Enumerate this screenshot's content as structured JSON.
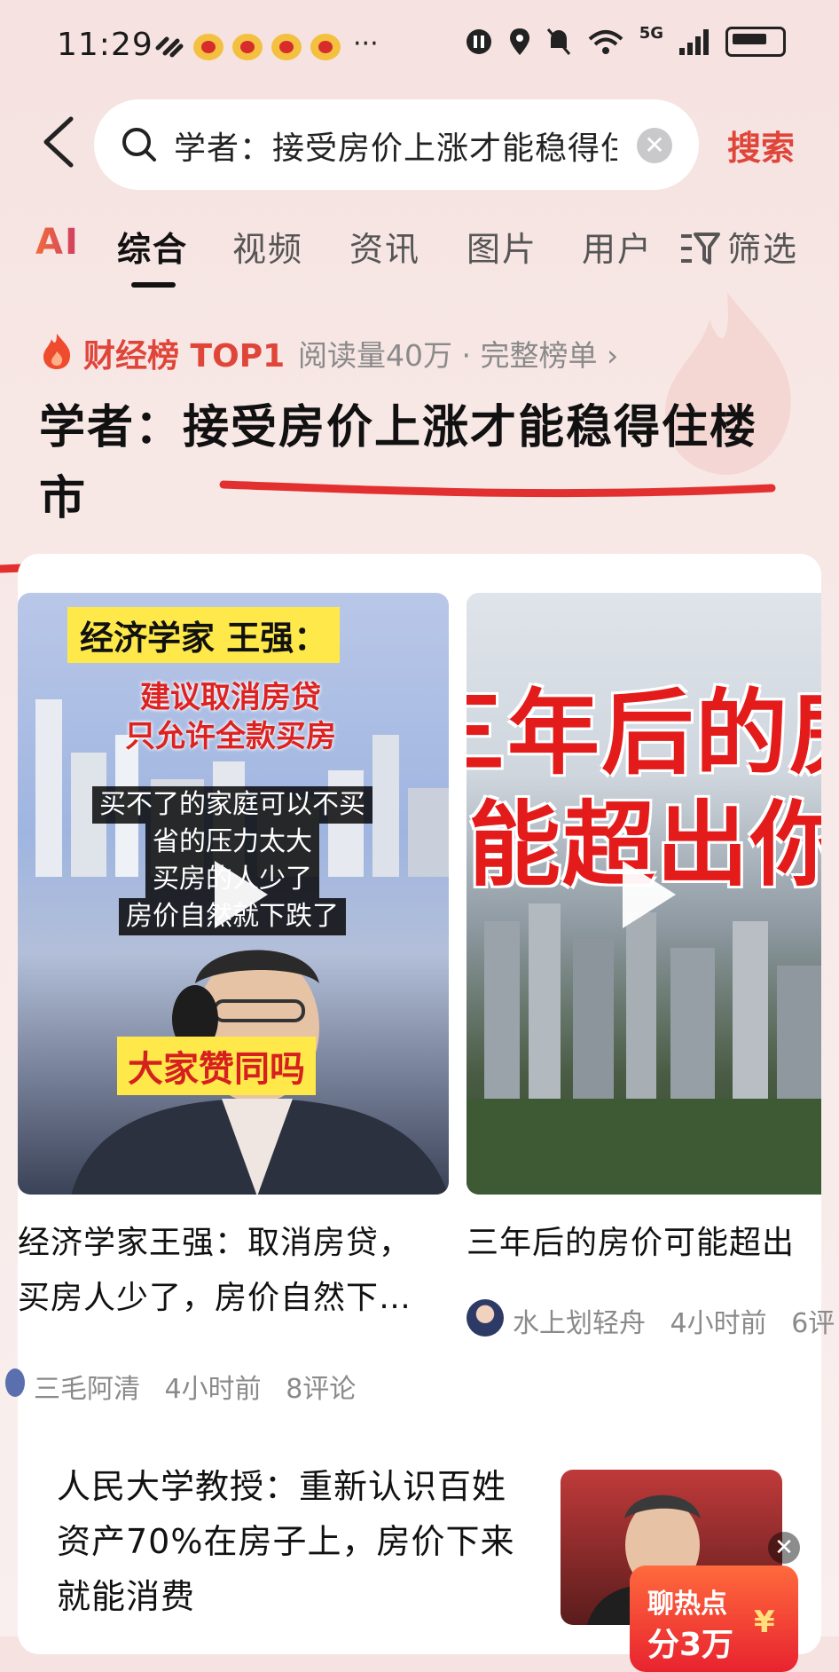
{
  "status_bar": {
    "time": "11:29",
    "more": "···",
    "network": "5G",
    "icons": [
      "pause-icon",
      "location-icon",
      "mute-icon",
      "wifi-icon",
      "signal-icon",
      "battery-icon"
    ]
  },
  "search": {
    "query": "学者：接受房价上涨才能稳得住楼市",
    "button_label": "搜索"
  },
  "tabs": [
    {
      "label": "AI"
    },
    {
      "label": "综合",
      "active": true
    },
    {
      "label": "视频"
    },
    {
      "label": "资讯"
    },
    {
      "label": "图片"
    },
    {
      "label": "用户"
    },
    {
      "label": "筛选"
    }
  ],
  "hot": {
    "label": "财经榜 TOP1",
    "meta": "阅读量40万 · 完整榜单 ›"
  },
  "headline": "学者：接受房价上涨才能稳得住楼市",
  "video_cards": [
    {
      "overlay": {
        "top_caption": "经济学家 王强：",
        "red_line1": "建议取消房贷",
        "red_line2": "只允许全款买房",
        "black_line1": "买不了的家庭可以不买",
        "black_line2": "省的压力太大",
        "black_line3": "买房的人少了",
        "black_line4": "房价自然就下跌了",
        "agree": "大家赞同吗"
      },
      "title_line1": "经济学家王强：取消房贷，",
      "title_line2": "买房人少了，房价自然下…",
      "author": "三毛阿清",
      "time": "4小时前",
      "comments": "8评论"
    },
    {
      "overlay": {
        "big_line1": "三年后的房",
        "big_line2": "可能超出你的"
      },
      "title": "三年后的房价可能超出",
      "author": "水上划轻舟",
      "time": "4小时前",
      "comments": "6评"
    }
  ],
  "article": {
    "title": "人民大学教授：重新认识百姓资产70%在房子上，房价下来就能消费",
    "promo_line1": "聊热点",
    "promo_line2": "分3万",
    "promo_currency": "¥"
  },
  "colors": {
    "accent": "#e0453a",
    "annotation_red": "#e23030",
    "caption_yellow": "#ffe94a"
  }
}
